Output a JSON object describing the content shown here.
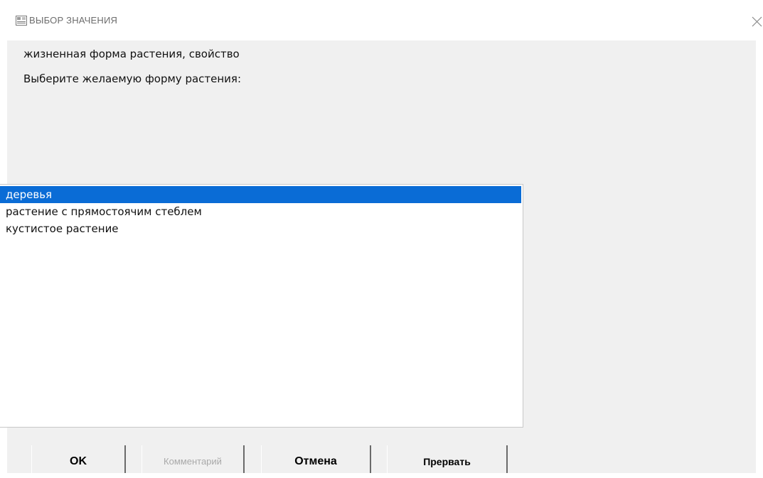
{
  "window": {
    "title": "ВЫБОР ЗНАЧЕНИЯ",
    "icon": "app-window-icon",
    "close_icon": "close-icon"
  },
  "labels": {
    "property": "жизненная форма растения, свойство",
    "prompt": "Выберите желаемую форму растения:"
  },
  "list": {
    "items": [
      {
        "label": "деревья",
        "selected": true
      },
      {
        "label": "растение с прямостоячим стеблем",
        "selected": false
      },
      {
        "label": "кустистое растение",
        "selected": false
      }
    ]
  },
  "buttons": {
    "ok": "OK",
    "comment": "Комментарий",
    "cancel": "Отмена",
    "abort": "Прервать"
  },
  "colors": {
    "selection": "#0a6cd6",
    "dialog_bg": "#f0f0f0"
  }
}
